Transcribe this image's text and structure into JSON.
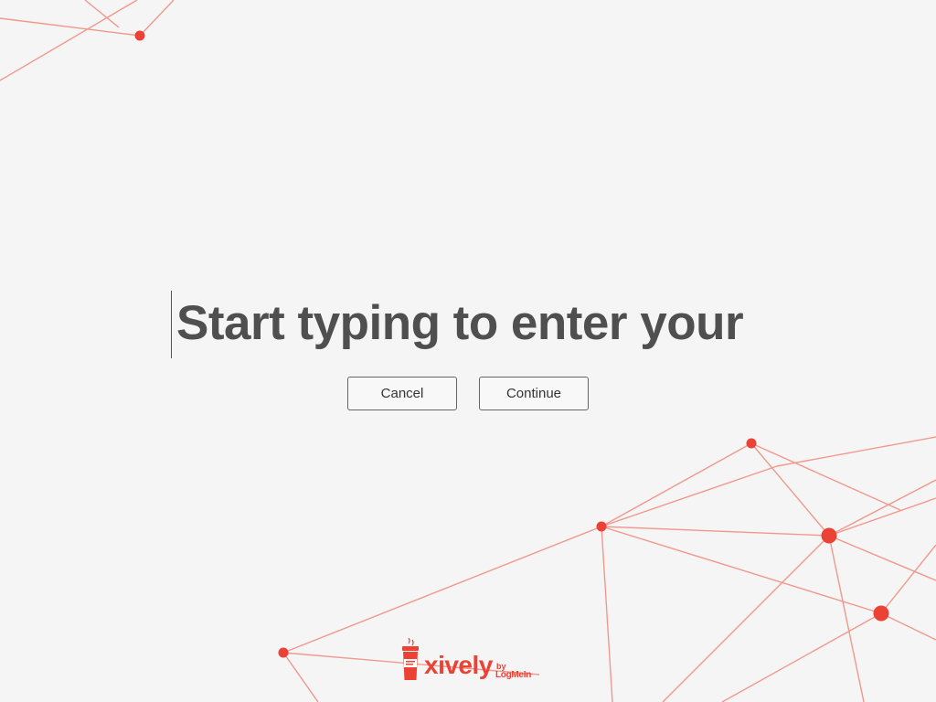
{
  "screen": {
    "prompt_text": "Start typing to enter your"
  },
  "buttons": {
    "cancel_label": "Cancel",
    "continue_label": "Continue"
  },
  "branding": {
    "product": "xively",
    "by": "by",
    "company": "LogMeIn",
    "cup_text": "",
    "icon": "coffee-cup-logo-icon"
  },
  "colors": {
    "accent": "#ec4135",
    "network_line": "#f1988c",
    "background": "#f5f5f5",
    "text": "#4f4f4f"
  }
}
